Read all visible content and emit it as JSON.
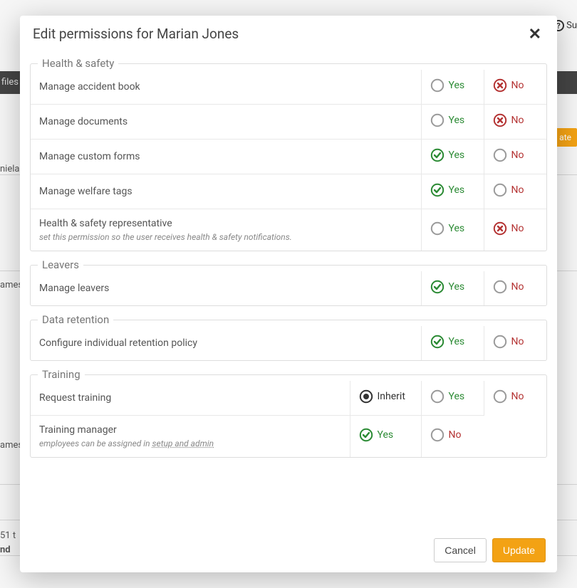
{
  "modal": {
    "title": "Edit permissions for Marian Jones",
    "close_label": "✕",
    "option_labels": {
      "inherit": "Inherit",
      "yes": "Yes",
      "no": "No"
    },
    "groups": [
      {
        "legend": "Health & safety",
        "rows": [
          {
            "label": "Manage accident book",
            "selected": "no",
            "show_inherit": false
          },
          {
            "label": "Manage documents",
            "selected": "no",
            "show_inherit": false
          },
          {
            "label": "Manage custom forms",
            "selected": "yes",
            "show_inherit": false
          },
          {
            "label": "Manage welfare tags",
            "selected": "yes",
            "show_inherit": false
          },
          {
            "label": "Health & safety representative",
            "desc": "set this permission so the user receives health & safety notifications.",
            "selected": "no",
            "show_inherit": false
          }
        ]
      },
      {
        "legend": "Leavers",
        "rows": [
          {
            "label": "Manage leavers",
            "selected": "yes",
            "show_inherit": false
          }
        ]
      },
      {
        "legend": "Data retention",
        "rows": [
          {
            "label": "Configure individual retention policy",
            "selected": "yes",
            "show_inherit": false
          }
        ]
      },
      {
        "legend": "Training",
        "rows": [
          {
            "label": "Request training",
            "selected": "inherit",
            "show_inherit": true
          },
          {
            "label": "Training manager",
            "desc_html": [
              "employees can be assigned in ",
              "setup and admin"
            ],
            "selected": "yes",
            "show_inherit": false
          }
        ]
      }
    ],
    "footer": {
      "cancel": "Cancel",
      "update": "Update"
    }
  },
  "bg": {
    "files": "files",
    "pill": "ate",
    "help": "Su",
    "a": "niela",
    "b": "ames,",
    "c": "ames,",
    "d": "51 t",
    "e": "nd"
  }
}
